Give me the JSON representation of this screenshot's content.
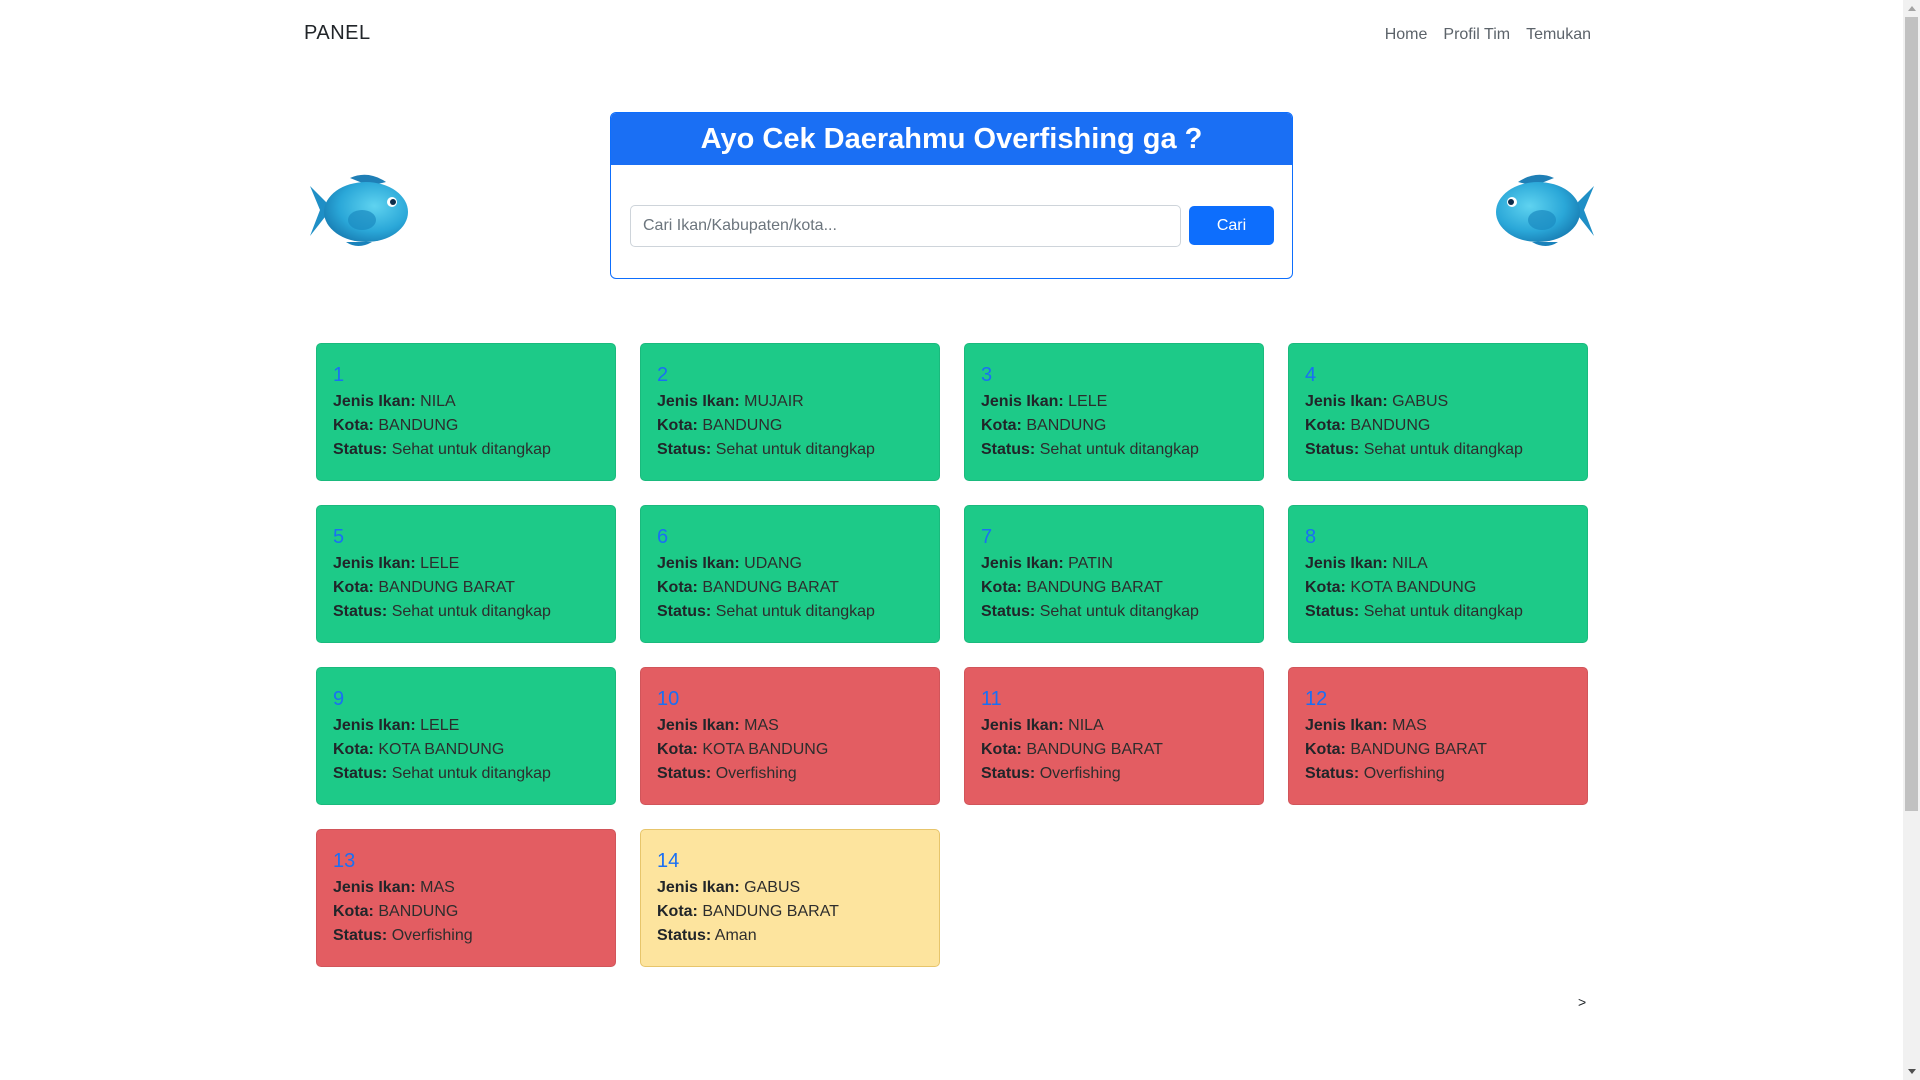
{
  "navbar": {
    "brand": "PANEL",
    "links": [
      "Home",
      "Profil Tim",
      "Temukan"
    ]
  },
  "search": {
    "title": "Ayo Cek Daerahmu Overfishing ga ?",
    "placeholder": "Cari Ikan/Kabupaten/kota...",
    "value": "",
    "button_label": "Cari"
  },
  "labels": {
    "jenis": "Jenis Ikan:",
    "kota": "Kota:",
    "status": "Status:"
  },
  "colors": {
    "primary": "#0d6efd",
    "healthy": "#1dca88",
    "overfishing": "#e35d62",
    "safe": "#fde49e"
  },
  "cards": [
    {
      "num": "1",
      "jenis": "NILA",
      "kota": "BANDUNG",
      "status": "Sehat untuk ditangkap",
      "tone": "green"
    },
    {
      "num": "2",
      "jenis": "MUJAIR",
      "kota": "BANDUNG",
      "status": "Sehat untuk ditangkap",
      "tone": "green"
    },
    {
      "num": "3",
      "jenis": "LELE",
      "kota": "BANDUNG",
      "status": "Sehat untuk ditangkap",
      "tone": "green"
    },
    {
      "num": "4",
      "jenis": "GABUS",
      "kota": "BANDUNG",
      "status": "Sehat untuk ditangkap",
      "tone": "green"
    },
    {
      "num": "5",
      "jenis": "LELE",
      "kota": "BANDUNG BARAT",
      "status": "Sehat untuk ditangkap",
      "tone": "green"
    },
    {
      "num": "6",
      "jenis": "UDANG",
      "kota": "BANDUNG BARAT",
      "status": "Sehat untuk ditangkap",
      "tone": "green"
    },
    {
      "num": "7",
      "jenis": "PATIN",
      "kota": "BANDUNG BARAT",
      "status": "Sehat untuk ditangkap",
      "tone": "green"
    },
    {
      "num": "8",
      "jenis": "NILA",
      "kota": "KOTA BANDUNG",
      "status": "Sehat untuk ditangkap",
      "tone": "green"
    },
    {
      "num": "9",
      "jenis": "LELE",
      "kota": "KOTA BANDUNG",
      "status": "Sehat untuk ditangkap",
      "tone": "green"
    },
    {
      "num": "10",
      "jenis": "MAS",
      "kota": "KOTA BANDUNG",
      "status": "Overfishing",
      "tone": "red"
    },
    {
      "num": "11",
      "jenis": "NILA",
      "kota": "BANDUNG BARAT",
      "status": "Overfishing",
      "tone": "red"
    },
    {
      "num": "12",
      "jenis": "MAS",
      "kota": "BANDUNG BARAT",
      "status": "Overfishing",
      "tone": "red"
    },
    {
      "num": "13",
      "jenis": "MAS",
      "kota": "BANDUNG",
      "status": "Overfishing",
      "tone": "red"
    },
    {
      "num": "14",
      "jenis": "GABUS",
      "kota": "BANDUNG BARAT",
      "status": "Aman",
      "tone": "yellow"
    }
  ],
  "pagination": {
    "next_label": ">"
  },
  "icons": {
    "fish_left": "fish-icon",
    "fish_right": "fish-icon"
  }
}
